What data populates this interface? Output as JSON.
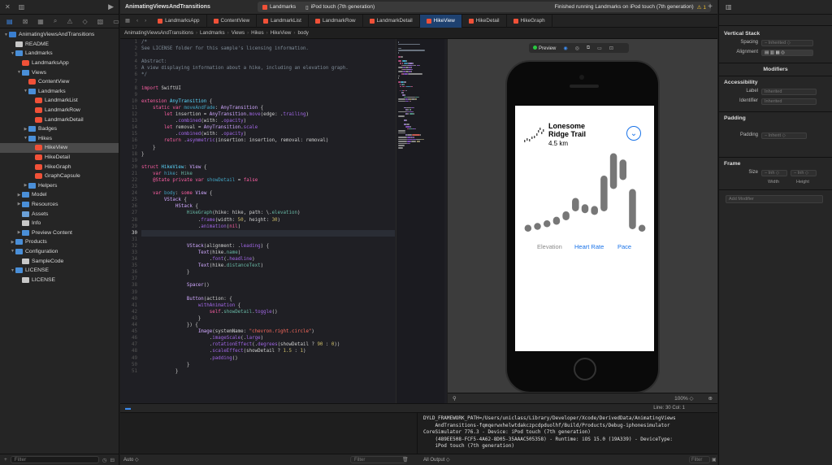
{
  "navigator": {
    "items": [
      {
        "label": "AnimatingViewsAndTransitions",
        "indent": 0,
        "icon": "proj",
        "tri": "▼"
      },
      {
        "label": "README",
        "indent": 1,
        "icon": "doc",
        "tri": ""
      },
      {
        "label": "Landmarks",
        "indent": 1,
        "icon": "folder",
        "tri": "▼"
      },
      {
        "label": "LandmarksApp",
        "indent": 2,
        "icon": "swift",
        "tri": ""
      },
      {
        "label": "Views",
        "indent": 2,
        "icon": "folder",
        "tri": "▼"
      },
      {
        "label": "ContentView",
        "indent": 3,
        "icon": "swift",
        "tri": ""
      },
      {
        "label": "Landmarks",
        "indent": 3,
        "icon": "folder",
        "tri": "▼"
      },
      {
        "label": "LandmarkList",
        "indent": 4,
        "icon": "swift",
        "tri": ""
      },
      {
        "label": "LandmarkRow",
        "indent": 4,
        "icon": "swift",
        "tri": ""
      },
      {
        "label": "LandmarkDetail",
        "indent": 4,
        "icon": "swift",
        "tri": ""
      },
      {
        "label": "Badges",
        "indent": 3,
        "icon": "folder",
        "tri": "▶"
      },
      {
        "label": "Hikes",
        "indent": 3,
        "icon": "folder",
        "tri": "▼"
      },
      {
        "label": "HikeView",
        "indent": 4,
        "icon": "swift",
        "tri": "",
        "selected": true
      },
      {
        "label": "HikeDetail",
        "indent": 4,
        "icon": "swift",
        "tri": ""
      },
      {
        "label": "HikeGraph",
        "indent": 4,
        "icon": "swift",
        "tri": ""
      },
      {
        "label": "GraphCapsule",
        "indent": 4,
        "icon": "swift",
        "tri": ""
      },
      {
        "label": "Helpers",
        "indent": 3,
        "icon": "folder",
        "tri": "▶"
      },
      {
        "label": "Model",
        "indent": 2,
        "icon": "folder",
        "tri": "▶"
      },
      {
        "label": "Resources",
        "indent": 2,
        "icon": "folder",
        "tri": "▶"
      },
      {
        "label": "Assets",
        "indent": 2,
        "icon": "asset",
        "tri": ""
      },
      {
        "label": "Info",
        "indent": 2,
        "icon": "doc",
        "tri": ""
      },
      {
        "label": "Preview Content",
        "indent": 2,
        "icon": "folder",
        "tri": "▶"
      },
      {
        "label": "Products",
        "indent": 1,
        "icon": "folder",
        "tri": "▶"
      },
      {
        "label": "Configuration",
        "indent": 1,
        "icon": "folder",
        "tri": "▼"
      },
      {
        "label": "SampleCode",
        "indent": 2,
        "icon": "doc",
        "tri": ""
      },
      {
        "label": "LICENSE",
        "indent": 1,
        "icon": "folder",
        "tri": "▼"
      },
      {
        "label": "LICENSE",
        "indent": 2,
        "icon": "doc",
        "tri": ""
      }
    ],
    "filter_placeholder": "Filter"
  },
  "toolbar": {
    "scheme": "AnimatingViewsAndTransitions",
    "target": "Landmarks",
    "device": "iPod touch (7th generation)",
    "status": "Finished running Landmarks on iPod touch (7th generation)",
    "warning_count": "1"
  },
  "tabs": [
    {
      "label": "LandmarksApp",
      "active": false
    },
    {
      "label": "ContentView",
      "active": false
    },
    {
      "label": "LandmarkList",
      "active": false
    },
    {
      "label": "LandmarkRow",
      "active": false
    },
    {
      "label": "LandmarkDetail",
      "active": false
    },
    {
      "label": "HikeView",
      "active": true
    },
    {
      "label": "HikeDetail",
      "active": false
    },
    {
      "label": "HikeGraph",
      "active": false
    }
  ],
  "breadcrumb": [
    "AnimatingViewsAndTransitions",
    "Landmarks",
    "Views",
    "Hikes",
    "HikeView",
    "body"
  ],
  "editor": {
    "start_line": 1,
    "current_line": 30,
    "lines": [
      [
        [
          "/*",
          "cm"
        ]
      ],
      [
        [
          "See LICENSE folder for this sample's licensing information.",
          "cm"
        ]
      ],
      [],
      [
        [
          "Abstract:",
          "cm"
        ]
      ],
      [
        [
          "A view displaying information about a hike, including an elevation graph.",
          "cm"
        ]
      ],
      [
        [
          "*/",
          "cm"
        ]
      ],
      [],
      [
        [
          "import",
          "kw"
        ],
        [
          " SwiftUI",
          ""
        ]
      ],
      [],
      [
        [
          "extension",
          "kw"
        ],
        [
          " ",
          ""
        ],
        [
          "AnyTransition",
          "ty"
        ],
        [
          " {",
          ""
        ]
      ],
      [
        [
          "    ",
          ""
        ],
        [
          "static",
          "kw"
        ],
        [
          " ",
          ""
        ],
        [
          "var",
          "kw"
        ],
        [
          " ",
          ""
        ],
        [
          "moveAndFade",
          "id"
        ],
        [
          ": ",
          ""
        ],
        [
          "AnyTransition",
          "tp"
        ],
        [
          " {",
          ""
        ]
      ],
      [
        [
          "        ",
          ""
        ],
        [
          "let",
          "kw"
        ],
        [
          " insertion = ",
          ""
        ],
        [
          "AnyTransition",
          "tp"
        ],
        [
          ".",
          ""
        ],
        [
          "move",
          "pr"
        ],
        [
          "(edge: .",
          ""
        ],
        [
          "trailing",
          "pr"
        ],
        [
          ")",
          ""
        ]
      ],
      [
        [
          "            .",
          ""
        ],
        [
          "combined",
          "pr"
        ],
        [
          "(with: .",
          ""
        ],
        [
          "opacity",
          "pr"
        ],
        [
          ")",
          ""
        ]
      ],
      [
        [
          "        ",
          ""
        ],
        [
          "let",
          "kw"
        ],
        [
          " removal = ",
          ""
        ],
        [
          "AnyTransition",
          "tp"
        ],
        [
          ".",
          ""
        ],
        [
          "scale",
          "pr"
        ],
        [
          "",
          ""
        ]
      ],
      [
        [
          "            .",
          ""
        ],
        [
          "combined",
          "pr"
        ],
        [
          "(with: .",
          ""
        ],
        [
          "opacity",
          "pr"
        ],
        [
          ")",
          ""
        ]
      ],
      [
        [
          "        ",
          ""
        ],
        [
          "return",
          "kw"
        ],
        [
          " .",
          ""
        ],
        [
          "asymmetric",
          "pr"
        ],
        [
          "(insertion: insertion, removal: removal)",
          ""
        ]
      ],
      [
        [
          "    }",
          ""
        ]
      ],
      [
        [
          "}",
          ""
        ]
      ],
      [],
      [
        [
          "struct",
          "kw"
        ],
        [
          " ",
          ""
        ],
        [
          "HikeView",
          "ty"
        ],
        [
          ": ",
          ""
        ],
        [
          "View",
          "tp"
        ],
        [
          " {",
          ""
        ]
      ],
      [
        [
          "    ",
          ""
        ],
        [
          "var",
          "kw"
        ],
        [
          " ",
          ""
        ],
        [
          "hike",
          "id"
        ],
        [
          ": ",
          ""
        ],
        [
          "Hike",
          "fn"
        ]
      ],
      [
        [
          "    ",
          ""
        ],
        [
          "@State",
          "kw"
        ],
        [
          " ",
          ""
        ],
        [
          "private",
          "kw"
        ],
        [
          " ",
          ""
        ],
        [
          "var",
          "kw"
        ],
        [
          " ",
          ""
        ],
        [
          "showDetail",
          "id"
        ],
        [
          " = ",
          ""
        ],
        [
          "false",
          "kw"
        ]
      ],
      [],
      [
        [
          "    ",
          ""
        ],
        [
          "var",
          "kw"
        ],
        [
          " ",
          ""
        ],
        [
          "body",
          "id"
        ],
        [
          ": ",
          ""
        ],
        [
          "some",
          "kw"
        ],
        [
          " ",
          ""
        ],
        [
          "View",
          "tp"
        ],
        [
          " {",
          ""
        ]
      ],
      [
        [
          "        ",
          ""
        ],
        [
          "VStack",
          "tp"
        ],
        [
          " {",
          ""
        ]
      ],
      [
        [
          "            ",
          ""
        ],
        [
          "HStack",
          "tp"
        ],
        [
          " {",
          ""
        ]
      ],
      [
        [
          "                ",
          ""
        ],
        [
          "HikeGraph",
          "fn"
        ],
        [
          "(hike: hike, path: \\.",
          ""
        ],
        [
          "elevation",
          "fn"
        ],
        [
          ")",
          ""
        ]
      ],
      [
        [
          "                    .",
          ""
        ],
        [
          "frame",
          "pr"
        ],
        [
          "(width: ",
          ""
        ],
        [
          "50",
          "nu"
        ],
        [
          ", height: ",
          ""
        ],
        [
          "30",
          "nu"
        ],
        [
          ")",
          ""
        ]
      ],
      [
        [
          "                    .",
          ""
        ],
        [
          "animation",
          "pr"
        ],
        [
          "(",
          ""
        ],
        [
          "nil",
          "kw"
        ],
        [
          ")",
          ""
        ]
      ],
      [],
      [],
      [
        [
          "                ",
          ""
        ],
        [
          "VStack",
          "tp"
        ],
        [
          "(alignment: .",
          ""
        ],
        [
          "leading",
          "pr"
        ],
        [
          ") {",
          ""
        ]
      ],
      [
        [
          "                    ",
          ""
        ],
        [
          "Text",
          "tp"
        ],
        [
          "(hike.",
          ""
        ],
        [
          "name",
          "fn"
        ],
        [
          ")",
          ""
        ]
      ],
      [
        [
          "                        .",
          ""
        ],
        [
          "font",
          "pr"
        ],
        [
          "(.",
          ""
        ],
        [
          "headline",
          "pr"
        ],
        [
          ")",
          ""
        ]
      ],
      [
        [
          "                    ",
          ""
        ],
        [
          "Text",
          "tp"
        ],
        [
          "(hike.",
          ""
        ],
        [
          "distanceText",
          "fn"
        ],
        [
          ")",
          ""
        ]
      ],
      [
        [
          "                }",
          ""
        ]
      ],
      [],
      [
        [
          "                ",
          ""
        ],
        [
          "Spacer",
          "tp"
        ],
        [
          "()",
          ""
        ]
      ],
      [],
      [
        [
          "                ",
          ""
        ],
        [
          "Button",
          "tp"
        ],
        [
          "(action: {",
          ""
        ]
      ],
      [
        [
          "                    ",
          ""
        ],
        [
          "withAnimation",
          "pr"
        ],
        [
          " {",
          ""
        ]
      ],
      [
        [
          "                        ",
          ""
        ],
        [
          "self",
          "kw"
        ],
        [
          ".",
          ""
        ],
        [
          "showDetail",
          "fn"
        ],
        [
          ".",
          ""
        ],
        [
          "toggle",
          "pr"
        ],
        [
          "()",
          ""
        ]
      ],
      [
        [
          "                    }",
          ""
        ]
      ],
      [
        [
          "                }) {",
          ""
        ]
      ],
      [
        [
          "                    ",
          ""
        ],
        [
          "Image",
          "tp"
        ],
        [
          "(systemName: ",
          ""
        ],
        [
          "\"chevron.right.circle\"",
          "st"
        ],
        [
          ")",
          ""
        ]
      ],
      [
        [
          "                        .",
          ""
        ],
        [
          "imageScale",
          "pr"
        ],
        [
          "(.",
          ""
        ],
        [
          "large",
          "pr"
        ],
        [
          ")",
          ""
        ]
      ],
      [
        [
          "                        .",
          ""
        ],
        [
          "rotationEffect",
          "pr"
        ],
        [
          "(.",
          ""
        ],
        [
          "degrees",
          "pr"
        ],
        [
          "(showDetail ? ",
          ""
        ],
        [
          "90",
          "nu"
        ],
        [
          " : ",
          ""
        ],
        [
          "0",
          "nu"
        ],
        [
          "))",
          ""
        ]
      ],
      [
        [
          "                        .",
          ""
        ],
        [
          "scaleEffect",
          "pr"
        ],
        [
          "(showDetail ? ",
          ""
        ],
        [
          "1.5",
          "nu"
        ],
        [
          " : ",
          ""
        ],
        [
          "1",
          "nu"
        ],
        [
          ")",
          ""
        ]
      ],
      [
        [
          "                        .",
          ""
        ],
        [
          "padding",
          "pr"
        ],
        [
          "()",
          ""
        ]
      ],
      [
        [
          "                }",
          ""
        ]
      ],
      [
        [
          "            }",
          ""
        ]
      ]
    ]
  },
  "preview": {
    "label": "Preview",
    "hike_name": "Lonesome Ridge Trail",
    "hike_distance": "4.5 km",
    "tabs": [
      "Elevation",
      "Heart Rate",
      "Pace"
    ],
    "zoom": "100%",
    "bars": [
      {
        "low": 0.08,
        "high": 0.15
      },
      {
        "low": 0.1,
        "high": 0.17
      },
      {
        "low": 0.13,
        "high": 0.2
      },
      {
        "low": 0.15,
        "high": 0.24
      },
      {
        "low": 0.2,
        "high": 0.3
      },
      {
        "low": 0.3,
        "high": 0.45
      },
      {
        "low": 0.28,
        "high": 0.38
      },
      {
        "low": 0.26,
        "high": 0.36
      },
      {
        "low": 0.3,
        "high": 0.7
      },
      {
        "low": 0.55,
        "high": 0.95
      },
      {
        "low": 0.65,
        "high": 0.88
      },
      {
        "low": 0.1,
        "high": 0.55
      },
      {
        "low": 0.08,
        "high": 0.15
      }
    ]
  },
  "debug": {
    "position": "Line: 30  Col: 1",
    "console": "DYLD_FRAMEWORK_PATH=/Users/uniclass/Library/Developer/Xcode/DerivedData/AnimatingViews\n    AndTransitions-fqmqerwxhelwtdakczpcdpduolhf/Build/Products/Debug-iphonesimulator\nCoreSimulator 776.3 - Device: iPod touch (7th generation)\n    (489EE508-FCF5-4A62-8D05-35AAAC505358) - Runtime: iOS 15.0 (19A339) - DeviceType:\n    iPod touch (7th generation)",
    "auto_label": "Auto ◇",
    "filter_placeholder": "Filter",
    "all_output": "All Output ◇",
    "filter2_placeholder": "Filter"
  },
  "inspector": {
    "vstack_title": "Vertical Stack",
    "spacing_label": "Spacing",
    "spacing_value": "Inherited",
    "alignment_label": "Alignment",
    "modifiers_title": "Modifiers",
    "accessibility_title": "Accessibility",
    "label_label": "Label",
    "label_value": "Inherited",
    "identifier_label": "Identifier",
    "identifier_value": "Inherited",
    "padding_title": "Padding",
    "padding_label": "Padding",
    "padding_value": "Inherit",
    "frame_title": "Frame",
    "size_label": "Size",
    "width_value": "Inh",
    "height_value": "Inh",
    "width_caption": "Width",
    "height_caption": "Height",
    "add_modifier": "Add Modifier"
  }
}
